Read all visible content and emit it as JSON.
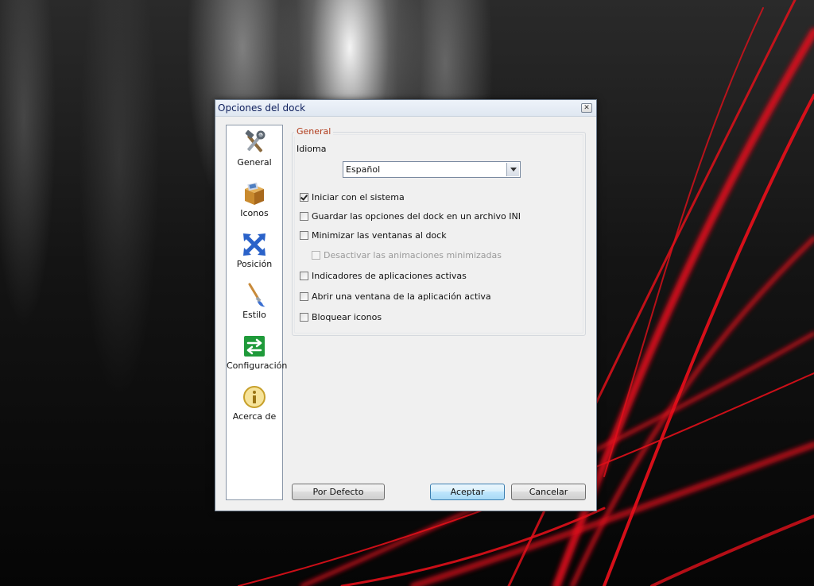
{
  "window": {
    "title": "Opciones del dock",
    "close_glyph": "✕"
  },
  "nav": {
    "items": [
      {
        "label": "General",
        "icon": "tools-icon"
      },
      {
        "label": "Iconos",
        "icon": "box-icon"
      },
      {
        "label": "Posición",
        "icon": "move-arrows-icon"
      },
      {
        "label": "Estilo",
        "icon": "paintbrush-icon"
      },
      {
        "label": "Configuración",
        "icon": "exchange-arrows-icon"
      },
      {
        "label": "Acerca de",
        "icon": "info-icon"
      }
    ]
  },
  "general": {
    "group_title": "General",
    "language_label": "Idioma",
    "language_value": "Español",
    "options": [
      {
        "label": "Iniciar con el sistema",
        "checked": true,
        "enabled": true
      },
      {
        "label": "Guardar las opciones del dock en un archivo INI",
        "checked": false,
        "enabled": true
      },
      {
        "label": "Minimizar las ventanas al dock",
        "checked": false,
        "enabled": true
      },
      {
        "label": "Desactivar las animaciones minimizadas",
        "checked": false,
        "enabled": false
      },
      {
        "label": "Indicadores de aplicaciones activas",
        "checked": false,
        "enabled": true
      },
      {
        "label": "Abrir una ventana de la aplicación activa",
        "checked": false,
        "enabled": true
      },
      {
        "label": "Bloquear iconos",
        "checked": false,
        "enabled": true
      }
    ]
  },
  "buttons": {
    "defaults": "Por Defecto",
    "accept": "Aceptar",
    "cancel": "Cancelar"
  },
  "colors": {
    "accent_title": "#b03a1a",
    "wallpaper_red": "#e0101a"
  }
}
